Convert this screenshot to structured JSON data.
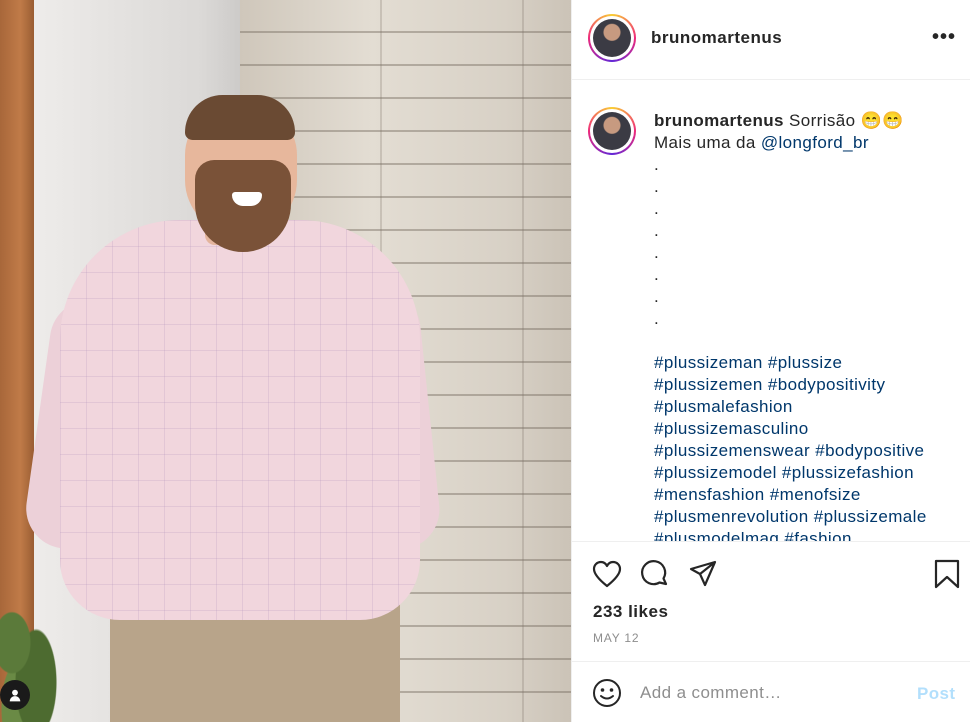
{
  "header": {
    "username": "brunomartenus",
    "more_label": "•••"
  },
  "caption": {
    "username": "brunomartenus",
    "text": "Sorrisão 😁😁",
    "line2_prefix": "Mais uma da ",
    "mention": "@longford_br",
    "dots": ".\n.\n.\n.\n.\n.\n.\n.",
    "hashtag_lines": [
      [
        "#plussizeman",
        "#plussize"
      ],
      [
        "#plussizemen",
        "#bodypositivity"
      ],
      [
        "#plusmalefashion"
      ],
      [
        "#plussizemasculino"
      ],
      [
        "#plussizemenswear",
        "#bodypositive"
      ],
      [
        "#plussizemodel",
        "#plussizefashion"
      ],
      [
        "#mensfashion",
        "#menofsize"
      ],
      [
        "#plusmenrevolution",
        "#plussizemale"
      ],
      [
        "#plusmodelmag",
        "#fashion"
      ]
    ]
  },
  "actions": {
    "likes": "233 likes",
    "date": "MAY 12",
    "icons": [
      "heart-icon",
      "comment-icon",
      "share-icon",
      "bookmark-icon"
    ]
  },
  "add_comment": {
    "placeholder": "Add a comment…",
    "post_label": "Post"
  },
  "colors": {
    "link": "#00376b",
    "muted": "#8e8e8e",
    "post_disabled": "#b2dffc",
    "border": "#efefef"
  }
}
